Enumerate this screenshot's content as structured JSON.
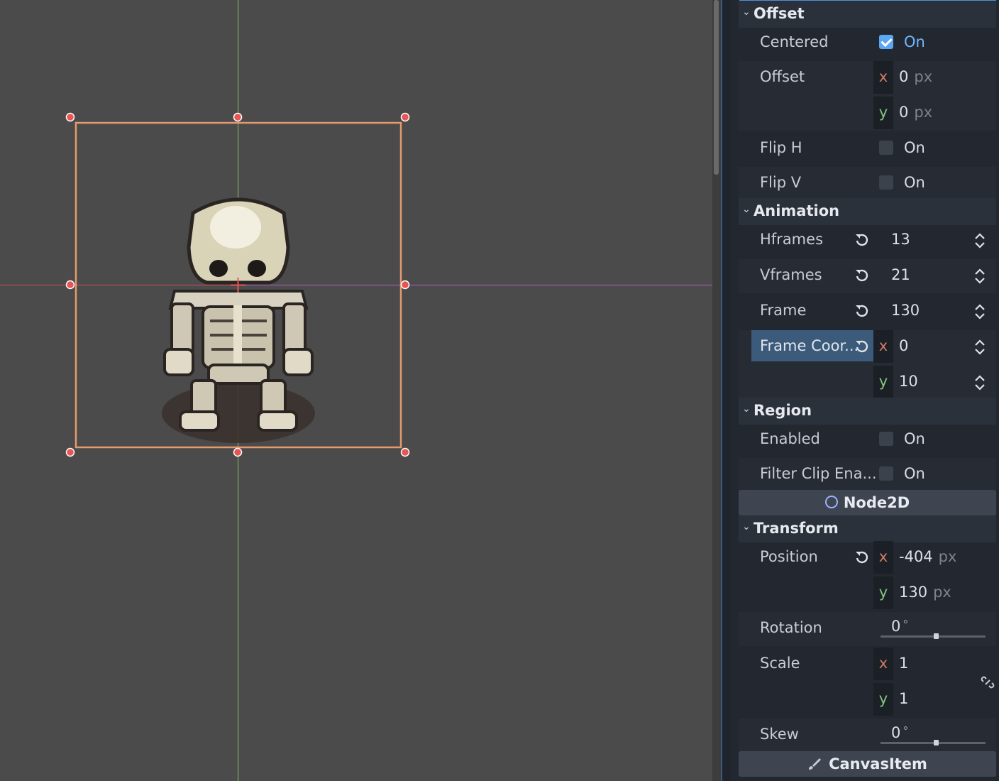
{
  "viewport": {
    "axis_colors": {
      "x_axis": "#d94a4a",
      "y_axis": "#7fbf5f",
      "right_axis": "#b45cc8"
    },
    "selection_color": "#e59a6e",
    "handle_color": "#e85555",
    "sprite": "skeleton-sprite"
  },
  "inspector": {
    "offset_section": {
      "title": "Offset",
      "centered": {
        "label": "Centered",
        "checked": true,
        "text": "On"
      },
      "offset": {
        "label": "Offset",
        "x_axis": "x",
        "x": "0",
        "y_axis": "y",
        "y": "0",
        "unit": "px"
      },
      "flip_h": {
        "label": "Flip H",
        "checked": false,
        "text": "On"
      },
      "flip_v": {
        "label": "Flip V",
        "checked": false,
        "text": "On"
      }
    },
    "animation_section": {
      "title": "Animation",
      "hframes": {
        "label": "Hframes",
        "value": "13"
      },
      "vframes": {
        "label": "Vframes",
        "value": "21"
      },
      "frame": {
        "label": "Frame",
        "value": "130"
      },
      "frame_coords": {
        "label": "Frame Coor...",
        "x_axis": "x",
        "x": "0",
        "y_axis": "y",
        "y": "10"
      }
    },
    "region_section": {
      "title": "Region",
      "enabled": {
        "label": "Enabled",
        "checked": false,
        "text": "On"
      },
      "filter_clip": {
        "label": "Filter Clip Ena...",
        "checked": false,
        "text": "On"
      }
    },
    "node2d_class": {
      "title": "Node2D",
      "icon": "circle-outline-icon"
    },
    "transform_section": {
      "title": "Transform",
      "position": {
        "label": "Position",
        "x_axis": "x",
        "x": "-404",
        "y_axis": "y",
        "y": "130",
        "unit": "px"
      },
      "rotation": {
        "label": "Rotation",
        "value": "0",
        "unit": "°"
      },
      "scale": {
        "label": "Scale",
        "x_axis": "x",
        "x": "1",
        "y_axis": "y",
        "y": "1"
      },
      "skew": {
        "label": "Skew",
        "value": "0",
        "unit": "°"
      }
    },
    "canvasitem_class": {
      "title": "CanvasItem",
      "icon": "brush-icon"
    }
  }
}
